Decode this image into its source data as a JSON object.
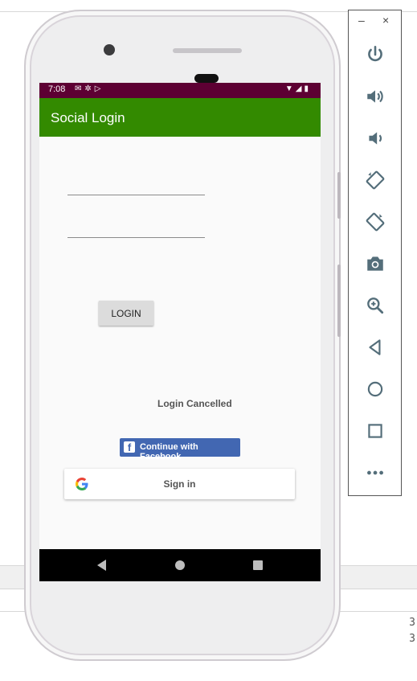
{
  "status_bar": {
    "time": "7:08",
    "left_icons": [
      "gmail-icon",
      "android-settings-icon",
      "play-icon"
    ],
    "right_icons": [
      "wifi-icon",
      "signal-icon",
      "battery-icon"
    ]
  },
  "app": {
    "title": "Social Login",
    "username_value": "",
    "password_value": "",
    "login_button": "LOGIN",
    "status_message": "Login Cancelled",
    "facebook_button": "Continue with Facebook",
    "google_button": "Sign in"
  },
  "emulator_toolbar": {
    "minimize": "–",
    "close": "×",
    "buttons": [
      "power-icon",
      "volume-up-icon",
      "volume-down-icon",
      "rotate-left-icon",
      "rotate-right-icon",
      "camera-icon",
      "zoom-icon",
      "back-icon",
      "home-icon",
      "overview-icon",
      "more-icon"
    ]
  },
  "ide": {
    "gutter_numbers": [
      "3",
      "3"
    ]
  },
  "colors": {
    "status_bar": "#5d0033",
    "app_bar": "#338a00",
    "facebook": "#4267b2",
    "nav_bar": "#000000"
  }
}
